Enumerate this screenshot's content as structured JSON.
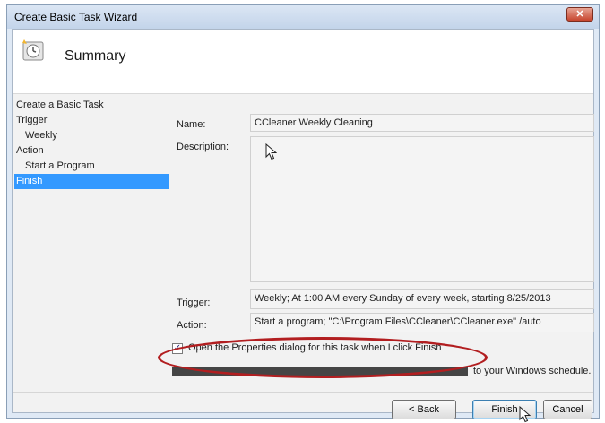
{
  "window": {
    "title": "Create Basic Task Wizard",
    "close_glyph": "✕"
  },
  "header": {
    "title": "Summary",
    "icon": "task-clock-icon"
  },
  "nav": {
    "items": [
      {
        "label": "Create a Basic Task"
      },
      {
        "label": "Trigger"
      },
      {
        "label": "Weekly"
      },
      {
        "label": "Action"
      },
      {
        "label": "Start a Program"
      },
      {
        "label": "Finish"
      }
    ]
  },
  "summary": {
    "name_label": "Name:",
    "name_value": "CCleaner Weekly Cleaning",
    "description_label": "Description:",
    "description_value": "",
    "trigger_label": "Trigger:",
    "trigger_value": "Weekly; At 1:00 AM every Sunday of every week, starting 8/25/2013",
    "action_label": "Action:",
    "action_value": "Start a program; \"C:\\Program Files\\CCleaner\\CCleaner.exe\" /auto"
  },
  "options": {
    "open_properties_label": "Open the Properties dialog for this task when I click Finish",
    "open_properties_checked": true,
    "checkmark": "✓",
    "info_text": "to your Windows schedule."
  },
  "buttons": {
    "back": "< Back",
    "finish": "Finish",
    "cancel": "Cancel"
  },
  "colors": {
    "selection": "#3399ff",
    "highlight": "#b21e20",
    "title_bar": "#c3d4ea"
  }
}
